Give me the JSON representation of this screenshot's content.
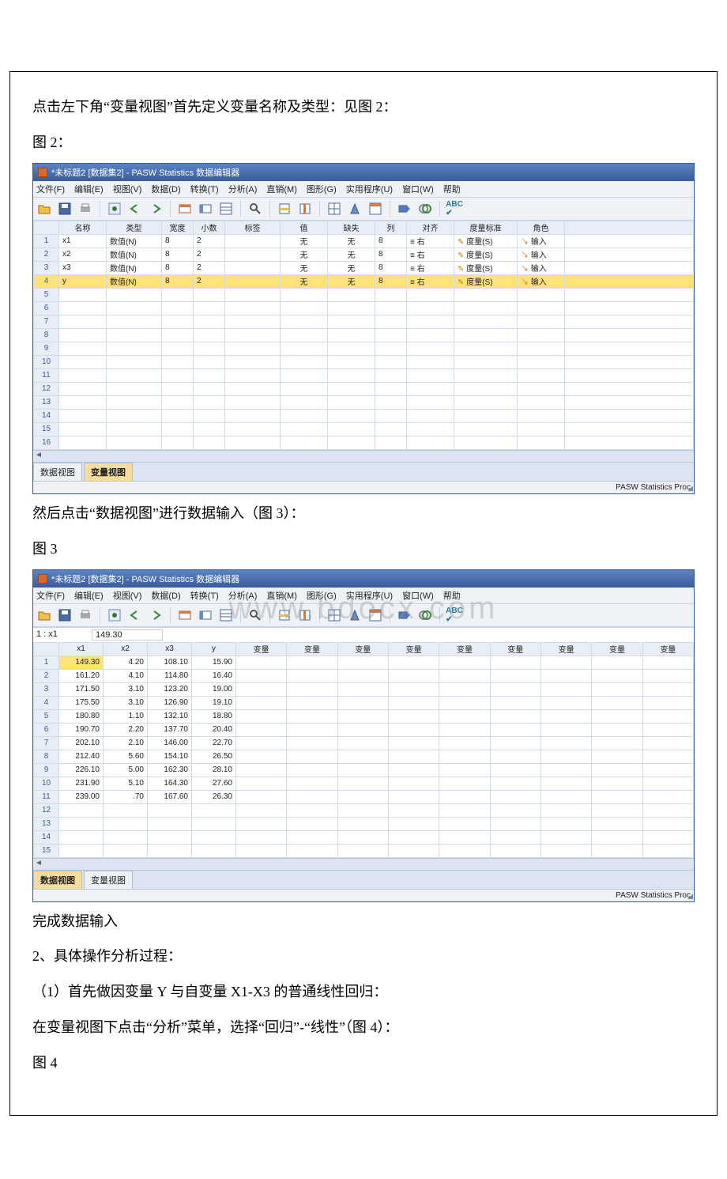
{
  "doc": {
    "para1": "点击左下角“变量视图”首先定义变量名称及类型：见图 2：",
    "label_fig2": "图 2：",
    "para2": "然后点击“数据视图”进行数据输入（图 3）：",
    "label_fig3": "图 3",
    "para3": "完成数据输入",
    "para4": "2、具体操作分析过程：",
    "para5": "（1）首先做因变量 Y 与自变量 X1-X3 的普通线性回归：",
    "para6": "在变量视图下点击“分析”菜单，选择“回归”-“线性”（图 4）：",
    "label_fig4": "图 4"
  },
  "app": {
    "title": "*未标题2 [数据集2] - PASW Statistics 数据编辑器",
    "status": "PASW Statistics Proc",
    "menus": [
      "文件(F)",
      "编辑(E)",
      "视图(V)",
      "数据(D)",
      "转换(T)",
      "分析(A)",
      "直销(M)",
      "图形(G)",
      "实用程序(U)",
      "窗口(W)",
      "帮助"
    ],
    "tabs": {
      "data": "数据视图",
      "variable": "变量视图"
    }
  },
  "fig2": {
    "headers": [
      "名称",
      "类型",
      "宽度",
      "小数",
      "标签",
      "值",
      "缺失",
      "列",
      "对齐",
      "度量标准",
      "角色"
    ],
    "rows": [
      {
        "n": "1",
        "name": "x1",
        "type": "数值(N)",
        "width": "8",
        "dec": "2",
        "label": "",
        "val": "无",
        "miss": "无",
        "col": "8",
        "align": "≡ 右",
        "measure": "✎ 度量(S)",
        "role": "↘ 输入"
      },
      {
        "n": "2",
        "name": "x2",
        "type": "数值(N)",
        "width": "8",
        "dec": "2",
        "label": "",
        "val": "无",
        "miss": "无",
        "col": "8",
        "align": "≡ 右",
        "measure": "✎ 度量(S)",
        "role": "↘ 输入"
      },
      {
        "n": "3",
        "name": "x3",
        "type": "数值(N)",
        "width": "8",
        "dec": "2",
        "label": "",
        "val": "无",
        "miss": "无",
        "col": "8",
        "align": "≡ 右",
        "measure": "✎ 度量(S)",
        "role": "↘ 输入"
      },
      {
        "n": "4",
        "name": "y",
        "type": "数值(N)",
        "width": "8",
        "dec": "2",
        "label": "",
        "val": "无",
        "miss": "无",
        "col": "8",
        "align": "≡ 右",
        "measure": "✎ 度量(S)",
        "role": "↘ 输入"
      }
    ],
    "emptyRows": [
      "5",
      "6",
      "7",
      "8",
      "9",
      "10",
      "11",
      "12",
      "13",
      "14",
      "15",
      "16"
    ],
    "activeTab": "variable"
  },
  "fig3": {
    "cellName": "1 : x1",
    "cellValue": "149.30",
    "headers": [
      "x1",
      "x2",
      "x3",
      "y",
      "变量",
      "变量",
      "变量",
      "变量",
      "变量",
      "变量",
      "变量",
      "变量",
      "变量"
    ],
    "rows": [
      {
        "n": "1",
        "x1": "149.30",
        "x2": "4.20",
        "x3": "108.10",
        "y": "15.90"
      },
      {
        "n": "2",
        "x1": "161.20",
        "x2": "4.10",
        "x3": "114.80",
        "y": "16.40"
      },
      {
        "n": "3",
        "x1": "171.50",
        "x2": "3.10",
        "x3": "123.20",
        "y": "19.00"
      },
      {
        "n": "4",
        "x1": "175.50",
        "x2": "3.10",
        "x3": "126.90",
        "y": "19.10"
      },
      {
        "n": "5",
        "x1": "180.80",
        "x2": "1.10",
        "x3": "132.10",
        "y": "18.80"
      },
      {
        "n": "6",
        "x1": "190.70",
        "x2": "2.20",
        "x3": "137.70",
        "y": "20.40"
      },
      {
        "n": "7",
        "x1": "202.10",
        "x2": "2.10",
        "x3": "146.00",
        "y": "22.70"
      },
      {
        "n": "8",
        "x1": "212.40",
        "x2": "5.60",
        "x3": "154.10",
        "y": "26.50"
      },
      {
        "n": "9",
        "x1": "226.10",
        "x2": "5.00",
        "x3": "162.30",
        "y": "28.10"
      },
      {
        "n": "10",
        "x1": "231.90",
        "x2": "5.10",
        "x3": "164.30",
        "y": "27.60"
      },
      {
        "n": "11",
        "x1": "239.00",
        "x2": ".70",
        "x3": "167.60",
        "y": "26.30"
      }
    ],
    "emptyRows": [
      "12",
      "13",
      "14",
      "15"
    ],
    "activeTab": "data"
  },
  "watermark": "www.bdocx.com"
}
